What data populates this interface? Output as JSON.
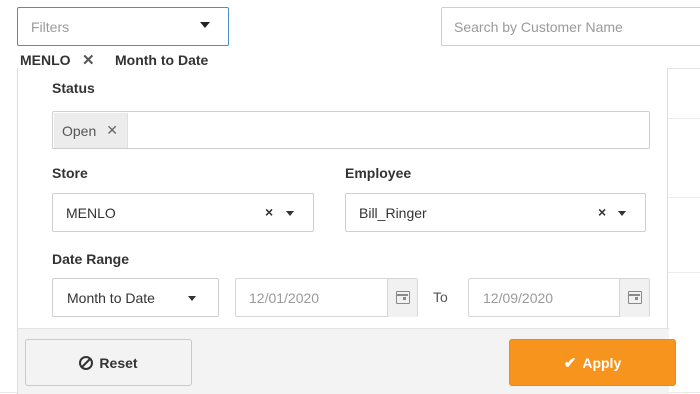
{
  "filters": {
    "placeholder": "Filters",
    "applied": [
      {
        "label": "MENLO",
        "removable": true
      },
      {
        "label": "Month to Date",
        "removable": false
      }
    ]
  },
  "search": {
    "placeholder": "Search by Customer Name"
  },
  "panel": {
    "status": {
      "label": "Status",
      "tags": [
        {
          "label": "Open",
          "remove_icon": "close-icon"
        }
      ]
    },
    "store": {
      "label": "Store",
      "value": "MENLO"
    },
    "employee": {
      "label": "Employee",
      "value": "Bill_Ringer"
    },
    "date_range": {
      "label": "Date Range",
      "preset": "Month to Date",
      "from": "12/01/2020",
      "to_label": "To",
      "to": "12/09/2020"
    },
    "buttons": {
      "reset_label": "Reset",
      "reset_icon": "ban-icon",
      "apply_label": "Apply",
      "apply_icon": "check-icon"
    }
  },
  "colors": {
    "apply_bg": "#f7941d",
    "focus_border": "#4a90c8"
  }
}
